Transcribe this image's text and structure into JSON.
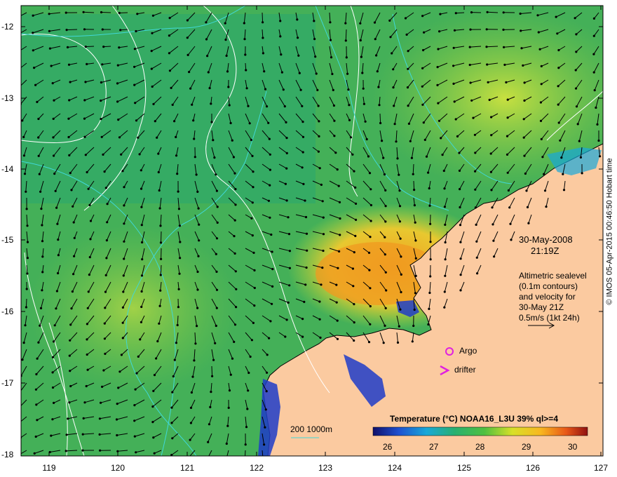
{
  "map": {
    "date_line": "30-May-2008",
    "time_line": "21:19Z",
    "legend_lines": [
      "Altimetric sealevel",
      "(0.1m contours)",
      "and velocity for",
      "30-May 21Z",
      "0.5m/s (1kt 24h)"
    ],
    "argo_label": "Argo",
    "drifter_label": "drifter",
    "depth_label": "200  1000m",
    "colorbar_title": "Temperature (°C) NOAA16_L3U 39% ql>=4",
    "colorbar_ticks": [
      "26",
      "27",
      "28",
      "29",
      "30"
    ],
    "credit": "© IMOS 05-Apr-2015 00:46:50 Hobart time",
    "lat_ticks": [
      "-12",
      "-13",
      "-14",
      "-15",
      "-16",
      "-17",
      "-18"
    ],
    "lon_ticks": [
      "119",
      "120",
      "121",
      "122",
      "123",
      "124",
      "125",
      "126",
      "127"
    ],
    "lon_range": [
      118.6,
      127
    ],
    "lat_range": [
      -18,
      -11.9
    ],
    "colors": {
      "land": "#fbcaa0",
      "warm": "#f4a020",
      "sea": "#44b058",
      "contour": "#ffffff",
      "bathymetry": "#40d8d8",
      "marker": "#e020e0"
    }
  }
}
